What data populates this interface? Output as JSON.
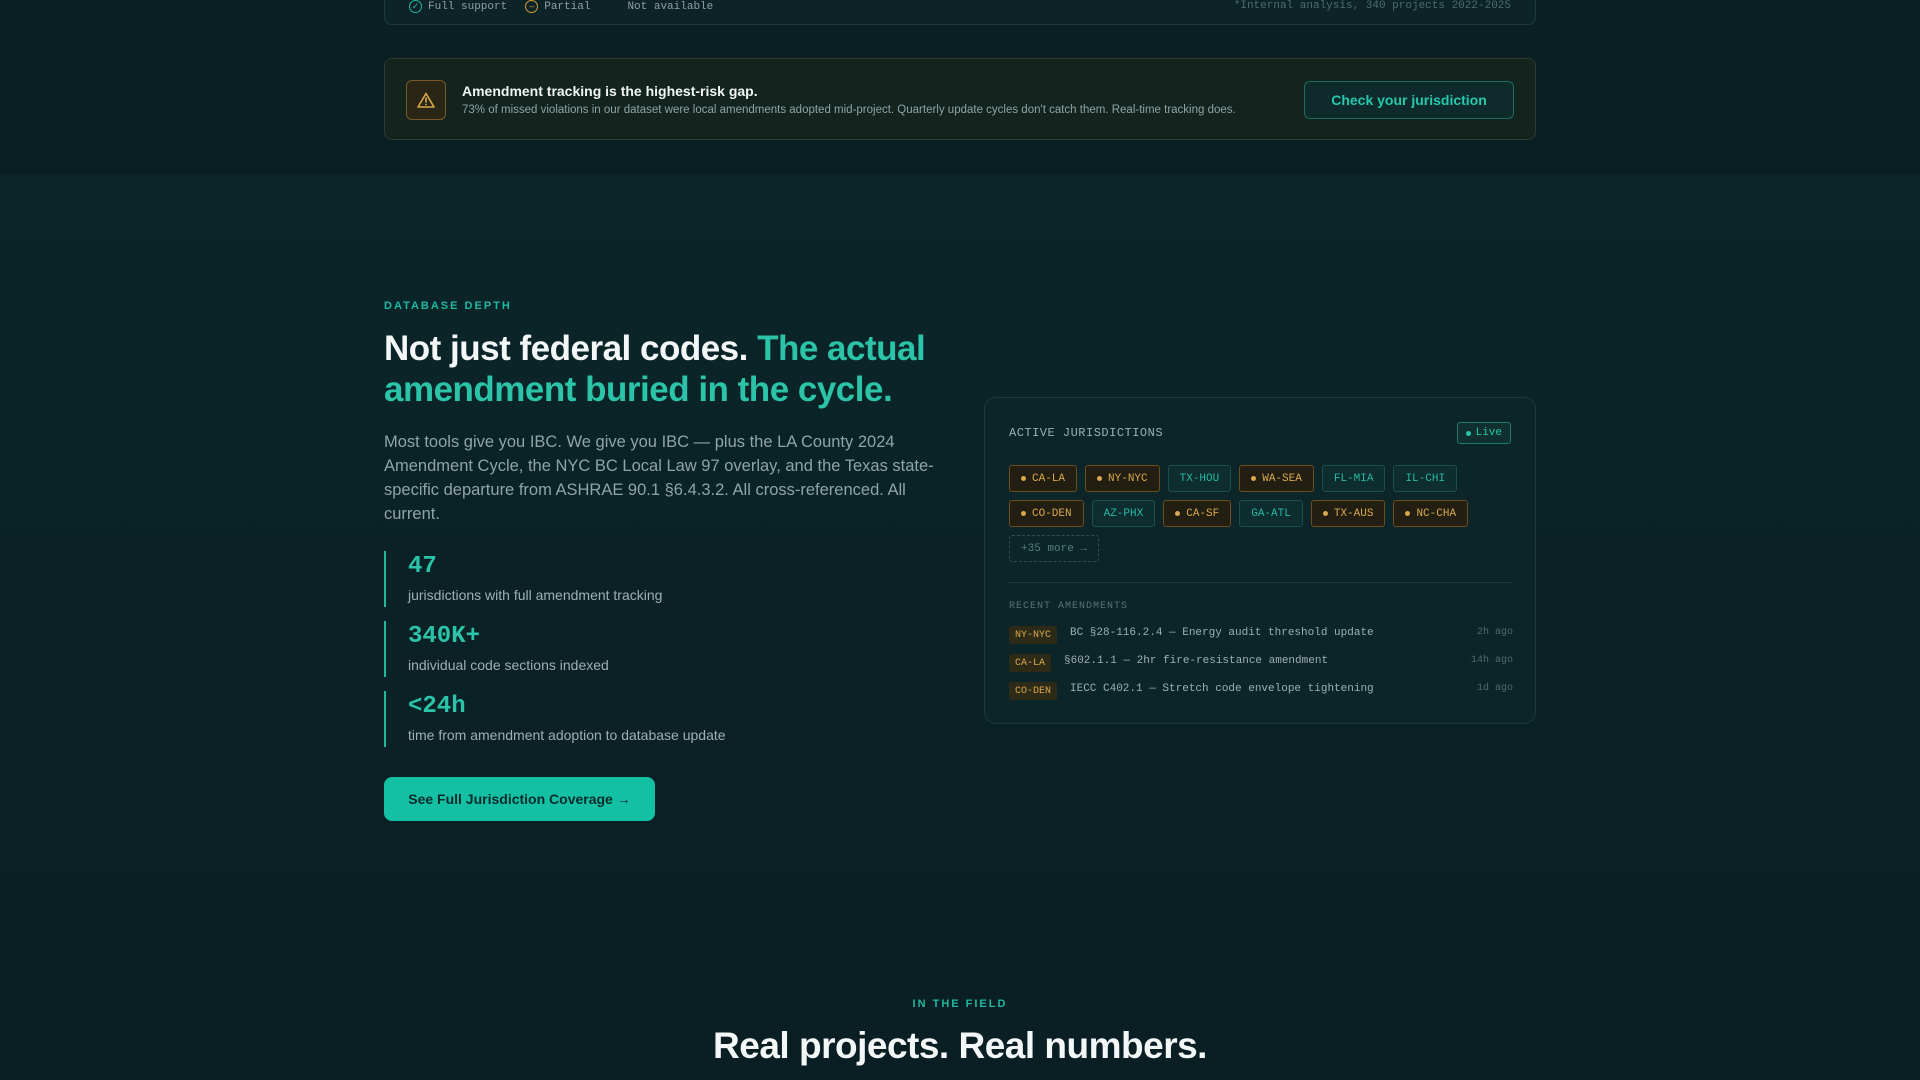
{
  "legend": {
    "items": [
      {
        "label": "Full support"
      },
      {
        "label": "Partial"
      },
      {
        "label": "Not available"
      }
    ],
    "note": "*Internal analysis, 340 projects 2022-2025"
  },
  "alert": {
    "title": "Amendment tracking is the highest-risk gap.",
    "text": "73% of missed violations in our dataset were local amendments adopted mid-project. Quarterly update cycles don't catch them. Real-time tracking does.",
    "button": "Check your jurisdiction"
  },
  "section": {
    "eyebrow": "DATABASE DEPTH",
    "headline_plain": "Not just federal codes.",
    "headline_accent": "The actual amendment buried in the cycle.",
    "description": "Most tools give you IBC. We give you IBC — plus the LA County 2024 Amendment Cycle, the NYC BC Local Law 97 overlay, and the Texas state-specific departure from ASHRAE 90.1 §6.4.3.2. All cross-referenced. All current.",
    "stats": [
      {
        "value": "47",
        "label": "jurisdictions with full amendment tracking"
      },
      {
        "value": "340K+",
        "label": "individual code sections indexed"
      },
      {
        "value": "<24h",
        "label": "time from amendment adoption to database update"
      }
    ],
    "cta": "See Full Jurisdiction Coverage →"
  },
  "card": {
    "title": "ACTIVE JURISDICTIONS",
    "live": "Live",
    "chips": [
      {
        "code": "CA-LA",
        "status": "partial"
      },
      {
        "code": "NY-NYC",
        "status": "partial"
      },
      {
        "code": "TX-HOU",
        "status": "full"
      },
      {
        "code": "WA-SEA",
        "status": "partial"
      },
      {
        "code": "FL-MIA",
        "status": "full"
      },
      {
        "code": "IL-CHI",
        "status": "full"
      },
      {
        "code": "CO-DEN",
        "status": "partial"
      },
      {
        "code": "AZ-PHX",
        "status": "full"
      },
      {
        "code": "CA-SF",
        "status": "partial"
      },
      {
        "code": "GA-ATL",
        "status": "full"
      },
      {
        "code": "TX-AUS",
        "status": "partial"
      },
      {
        "code": "NC-CHA",
        "status": "partial"
      }
    ],
    "more": "+35 more →",
    "recent_title": "RECENT AMENDMENTS",
    "amendments": [
      {
        "tag": "NY-NYC",
        "text": "BC §28-116.2.4 — Energy audit threshold update",
        "time": "2h ago"
      },
      {
        "tag": "CA-LA",
        "text": "§602.1.1 — 2hr fire-resistance amendment",
        "time": "14h ago"
      },
      {
        "tag": "CO-DEN",
        "text": "IECC C402.1 — Stretch code envelope tightening",
        "time": "1d ago"
      }
    ]
  },
  "field": {
    "eyebrow": "IN THE FIELD",
    "headline": "Real projects. Real numbers."
  },
  "colors": {
    "background": "#0a1f23",
    "accent": "#1fb9a2",
    "warning": "#d9a84b",
    "cta": "#14c0a3"
  }
}
